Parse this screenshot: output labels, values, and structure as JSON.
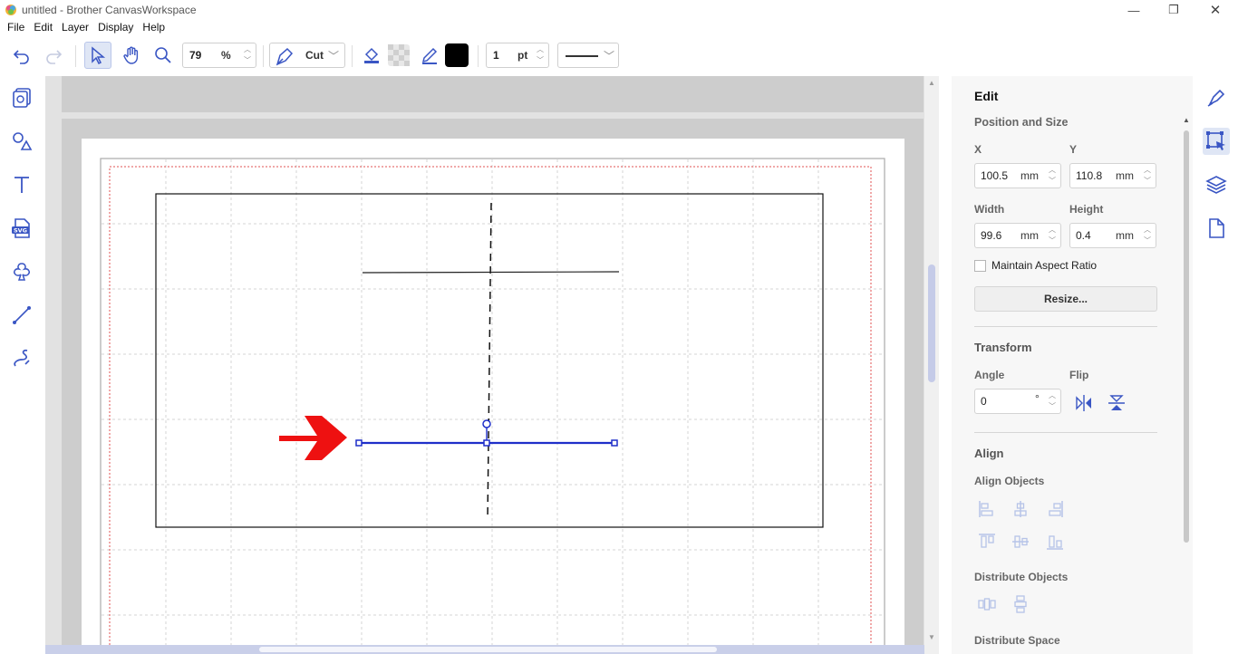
{
  "window": {
    "title": "untitled - Brother CanvasWorkspace",
    "minimize_glyph": "—",
    "maximize_glyph": "❐",
    "close_glyph": "✕"
  },
  "menu": [
    "File",
    "Edit",
    "Layer",
    "Display",
    "Help"
  ],
  "toolbar": {
    "zoom_value": "79",
    "zoom_unit": "%",
    "cut_mode": "Cut",
    "stroke_width": "1",
    "stroke_unit": "pt",
    "fill_color": "#000000",
    "accent": "#3a56c4"
  },
  "left_tools": [
    "pattern-library-icon",
    "shapes-icon",
    "text-icon",
    "svg-import-icon",
    "image-trace-icon",
    "line-tool-icon",
    "freehand-tool-icon"
  ],
  "right_tabs": [
    "edit-tab-icon",
    "transform-select-icon",
    "layers-icon",
    "page-icon"
  ],
  "props": {
    "heading": "Edit",
    "position_size": {
      "label": "Position and Size",
      "x_label": "X",
      "x_value": "100.5",
      "x_unit": "mm",
      "y_label": "Y",
      "y_value": "110.8",
      "y_unit": "mm",
      "width_label": "Width",
      "width_value": "99.6",
      "width_unit": "mm",
      "height_label": "Height",
      "height_value": "0.4",
      "height_unit": "mm",
      "aspect_label": "Maintain Aspect Ratio",
      "aspect_checked": false,
      "resize_label": "Resize..."
    },
    "transform": {
      "label": "Transform",
      "angle_label": "Angle",
      "angle_value": "0",
      "angle_unit": "°",
      "flip_label": "Flip"
    },
    "align": {
      "label": "Align",
      "align_objects_label": "Align Objects",
      "distribute_objects_label": "Distribute Objects",
      "distribute_space_label": "Distribute Space"
    }
  },
  "colors": {
    "selection": "#1f2fc9",
    "arrow": "#ee1111",
    "cut_area": "#e05050",
    "panel_bg": "#f7f7f7"
  }
}
